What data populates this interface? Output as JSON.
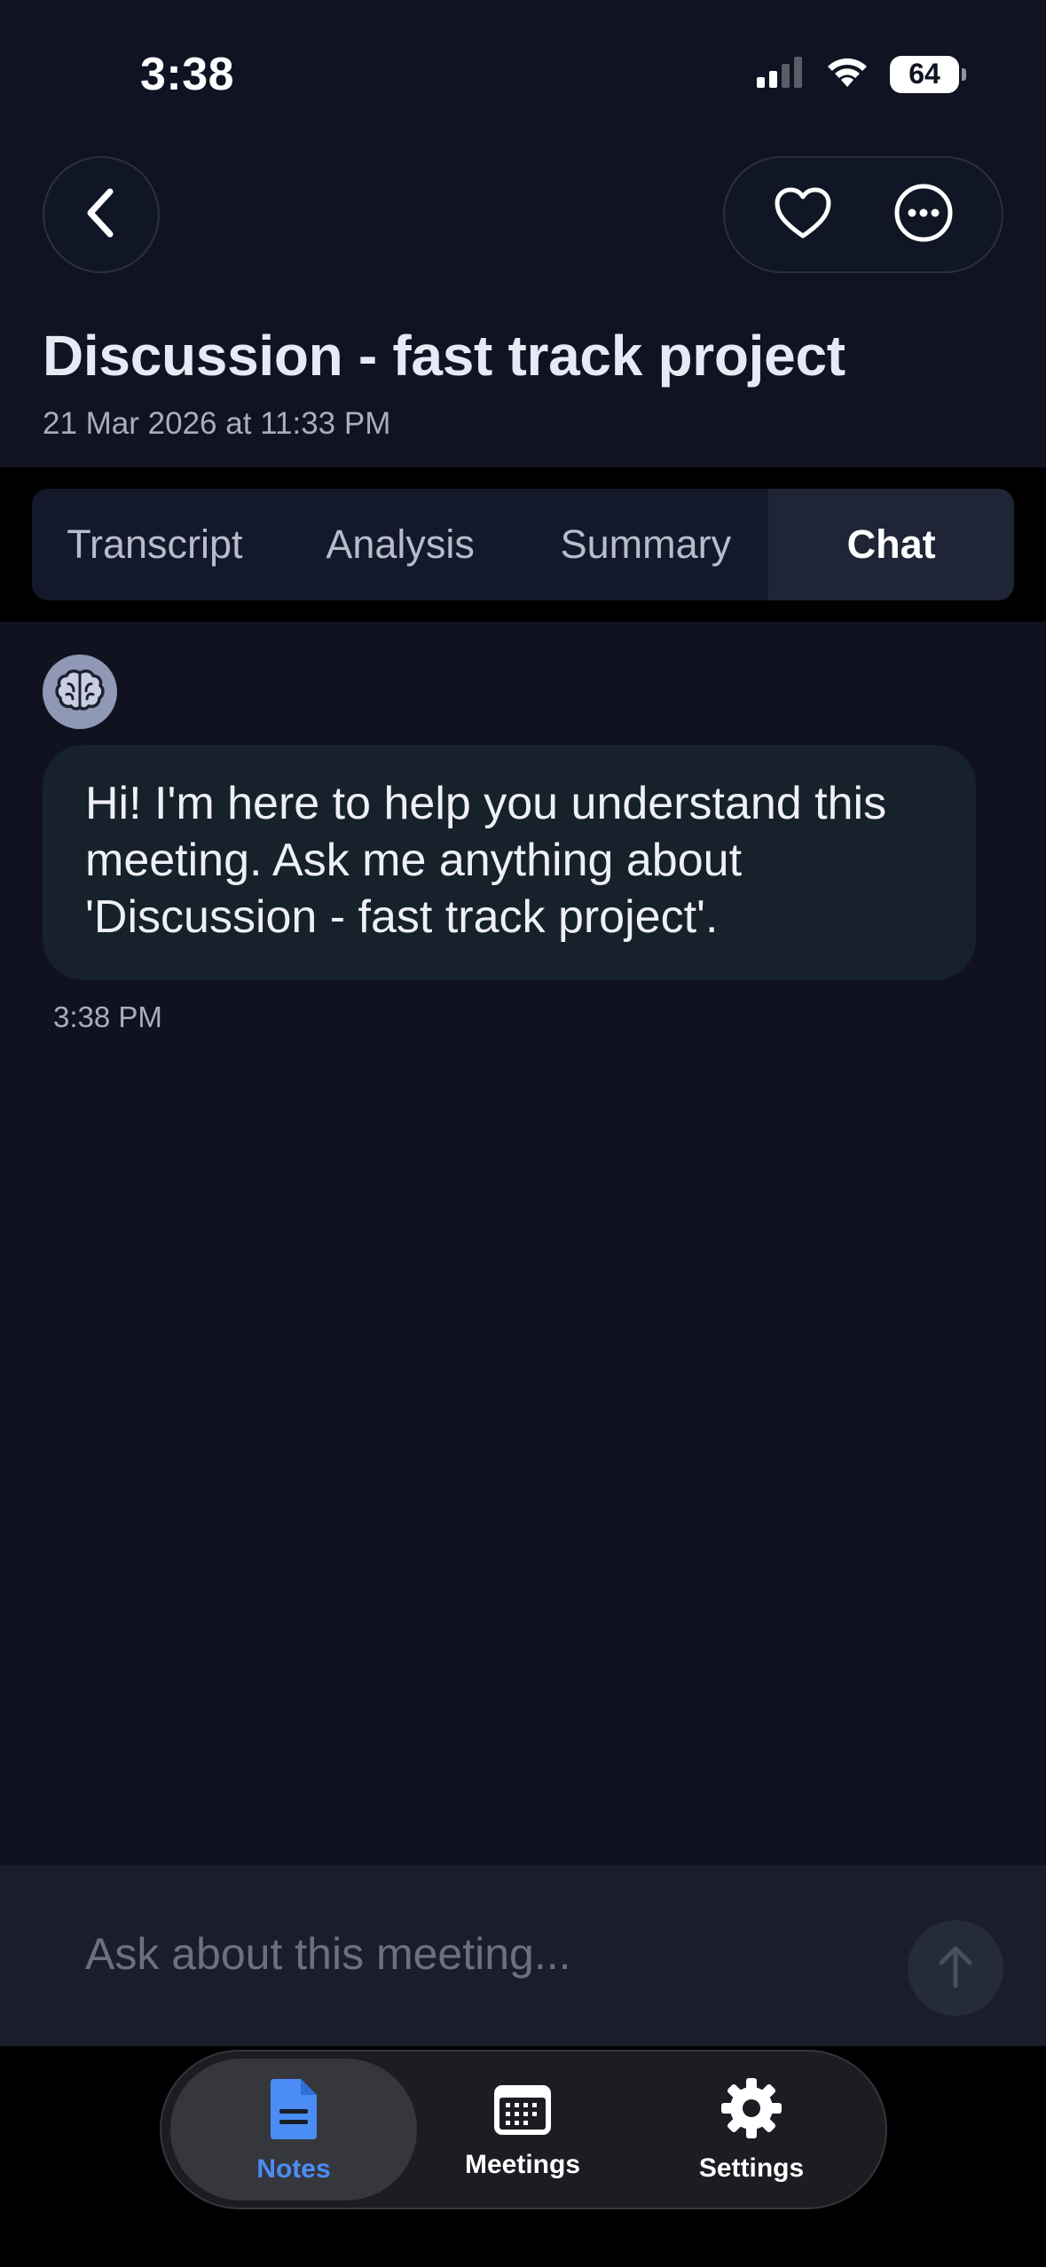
{
  "status_bar": {
    "time": "3:38",
    "battery": "64"
  },
  "header": {
    "title": "Discussion - fast track project",
    "date": "21 Mar 2026 at 11:33 PM"
  },
  "tabs": [
    {
      "label": "Transcript",
      "active": false
    },
    {
      "label": "Analysis",
      "active": false
    },
    {
      "label": "Summary",
      "active": false
    },
    {
      "label": "Chat",
      "active": true
    }
  ],
  "chat": {
    "assistant_icon": "brain-icon",
    "messages": [
      {
        "text": "Hi! I'm here to help you understand this meeting. Ask me anything about 'Discussion - fast track project'.",
        "time": "3:38 PM"
      }
    ]
  },
  "input": {
    "placeholder": "Ask about this meeting..."
  },
  "nav": {
    "items": [
      {
        "label": "Notes",
        "icon": "document-icon",
        "active": true
      },
      {
        "label": "Meetings",
        "icon": "calendar-icon",
        "active": false
      },
      {
        "label": "Settings",
        "icon": "gear-icon",
        "active": false
      }
    ]
  },
  "colors": {
    "accent": "#4b8df5",
    "background": "#10131f",
    "bubble": "#17212b"
  }
}
